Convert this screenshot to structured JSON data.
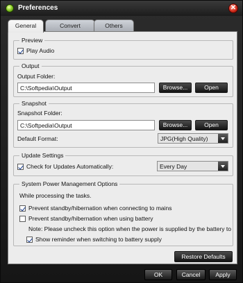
{
  "window": {
    "title": "Preferences"
  },
  "tabs": [
    {
      "label": "General",
      "active": true
    },
    {
      "label": "Convert",
      "active": false
    },
    {
      "label": "Others",
      "active": false
    }
  ],
  "preview": {
    "group_label": "Preview",
    "play_audio_label": "Play Audio",
    "play_audio_checked": true
  },
  "output": {
    "group_label": "Output",
    "folder_label": "Output Folder:",
    "folder_value": "C:\\Softpedia\\Output",
    "browse_label": "Browse...",
    "open_label": "Open"
  },
  "snapshot": {
    "group_label": "Snapshot",
    "folder_label": "Snapshot Folder:",
    "folder_value": "C:\\Softpedia\\Output",
    "browse_label": "Browse...",
    "open_label": "Open",
    "format_label": "Default Format:",
    "format_value": "JPG(High Quality)"
  },
  "update": {
    "group_label": "Update Settings",
    "check_label": "Check for Updates Automatically:",
    "check_checked": true,
    "frequency_value": "Every Day"
  },
  "power": {
    "group_label": "System Power Management Options",
    "intro_text": "While processing the tasks.",
    "prevent_mains_label": "Prevent standby/hibernation when connecting to mains",
    "prevent_mains_checked": true,
    "prevent_battery_label": "Prevent standby/hibernation when using battery",
    "prevent_battery_checked": false,
    "note_text": "Note: Please uncheck this option when the power is supplied by the battery to",
    "reminder_label": "Show reminder when switching to battery supply",
    "reminder_checked": true
  },
  "footer": {
    "restore_label": "Restore Defaults",
    "ok_label": "OK",
    "cancel_label": "Cancel",
    "apply_label": "Apply"
  },
  "colors": {
    "window_bg": "#1b1b1b",
    "panel_bg": "#ececec",
    "button_dark": "#1a1a1a",
    "check_mark": "#1a3f8f",
    "close_red": "#d42d1c"
  },
  "icons": {
    "app": "app-logo-icon",
    "close": "close-icon",
    "dropdown": "chevron-down-icon"
  }
}
